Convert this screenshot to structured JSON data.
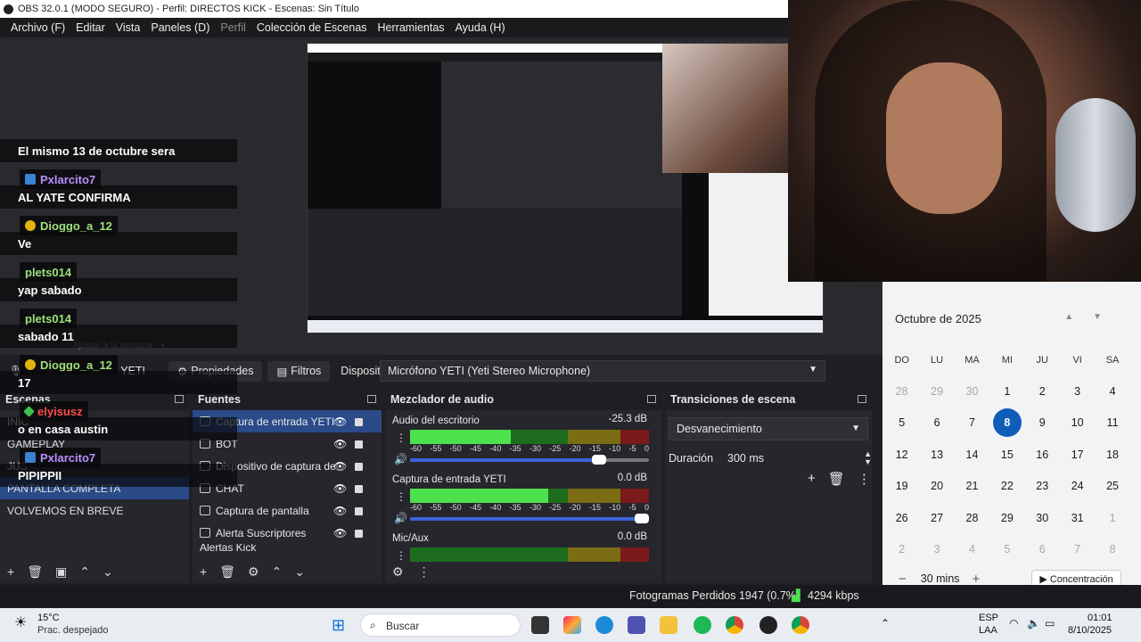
{
  "window": {
    "title": "OBS 32.0.1 (MODO SEGURO) - Perfil: DIRECTOS KICK - Escenas: Sin Título"
  },
  "menu": {
    "items": [
      "Archivo (F)",
      "Editar",
      "Vista",
      "Paneles (D)",
      "Perfil",
      "Colección de Escenas",
      "Herramientas",
      "Ayuda (H)"
    ]
  },
  "chat": {
    "lines": [
      {
        "type": "text",
        "text": "El mismo 13 de octubre sera"
      },
      {
        "type": "user",
        "user": "Pxlarcito7",
        "color": "#b990ff",
        "badge": "blue"
      },
      {
        "type": "text",
        "text": "AL YATE CONFIRMA"
      },
      {
        "type": "user",
        "user": "Dioggo_a_12",
        "color": "#9fe07a",
        "badge": "gold"
      },
      {
        "type": "text",
        "text": "Ve"
      },
      {
        "type": "user",
        "user": "plets014",
        "color": "#9fe07a",
        "badge": "none"
      },
      {
        "type": "text",
        "text": "yap sabado"
      },
      {
        "type": "user",
        "user": "plets014",
        "color": "#9fe07a",
        "badge": "none"
      },
      {
        "type": "text",
        "text": "sabado 11"
      },
      {
        "type": "user",
        "user": "Dioggo_a_12",
        "color": "#9fe07a",
        "badge": "gold"
      },
      {
        "type": "text",
        "text": "17"
      },
      {
        "type": "user",
        "user": "elyisusz",
        "color": "#ff4b4b",
        "badge": "green"
      },
      {
        "type": "text",
        "text": "o en casa austin"
      },
      {
        "type": "user",
        "user": "Pxlarcito7",
        "color": "#b990ff",
        "badge": "blue"
      },
      {
        "type": "text",
        "text": "PIPIPPII"
      }
    ]
  },
  "preview": {
    "fit_label": "Ajustar a la ventana"
  },
  "source_toolbar": {
    "source_name": "YETI",
    "properties": "Propiedades",
    "filters": "Filtros",
    "device_label": "Dispositivo",
    "device_value": "Micrófono YETI (Yeti Stereo Microphone)"
  },
  "scenes": {
    "title": "Escenas",
    "items": [
      "INIC",
      "GAMEPLAY",
      "JUS",
      "PANTALLA COMPLETA",
      "VOLVEMOS EN BREVE"
    ]
  },
  "sources": {
    "title": "Fuentes",
    "items": [
      "Captura de entrada YETI",
      "BOT",
      "Dispositivo de captura de",
      "CHAT",
      "Captura de pantalla",
      "Alerta Suscriptores",
      "Alertas Kick"
    ]
  },
  "mixer": {
    "title": "Mezclador de audio",
    "ticks": [
      "-60",
      "-55",
      "-50",
      "-45",
      "-40",
      "-35",
      "-30",
      "-25",
      "-20",
      "-15",
      "-10",
      "-5",
      "0"
    ],
    "channels": [
      {
        "name": "Audio del escritorio",
        "db": "-25.3 dB",
        "level": 0.42,
        "volume": 0.82
      },
      {
        "name": "Captura de entrada YETI",
        "db": "0.0 dB",
        "level": 0.58,
        "volume": 1.0
      },
      {
        "name": "Mic/Aux",
        "db": "0.0 dB",
        "level": 0.0,
        "volume": 1.0
      }
    ]
  },
  "transitions": {
    "title": "Transiciones de escena",
    "selected": "Desvanecimiento",
    "duration_label": "Duración",
    "duration_value": "300 ms"
  },
  "calendar": {
    "month": "Octubre de 2025",
    "dow": [
      "DO",
      "LU",
      "MA",
      "MI",
      "JU",
      "VI",
      "SA"
    ],
    "weeks": [
      [
        "28",
        "29",
        "30",
        "1",
        "2",
        "3",
        "4"
      ],
      [
        "5",
        "6",
        "7",
        "8",
        "9",
        "10",
        "11"
      ],
      [
        "12",
        "13",
        "14",
        "15",
        "16",
        "17",
        "18"
      ],
      [
        "19",
        "20",
        "21",
        "22",
        "23",
        "24",
        "25"
      ],
      [
        "26",
        "27",
        "28",
        "29",
        "30",
        "31",
        "1"
      ],
      [
        "2",
        "3",
        "4",
        "5",
        "6",
        "7",
        "8"
      ]
    ],
    "today": "8",
    "focus_minutes": "30 mins",
    "focus_button": "Concentración"
  },
  "status": {
    "dropped": "Fotogramas Perdidos 1947 (0.7%)",
    "bitrate": "4294 kbps"
  },
  "taskbar": {
    "weather_temp": "15°C",
    "weather_desc": "Prac. despejado",
    "search": "Buscar",
    "lang1": "ESP",
    "lang2": "LAA",
    "time": "01:01",
    "date": "8/10/2025"
  },
  "colors": {
    "accent": "#2a4a88",
    "today": "#0f5db8",
    "meter_green": "#4ee14e"
  }
}
